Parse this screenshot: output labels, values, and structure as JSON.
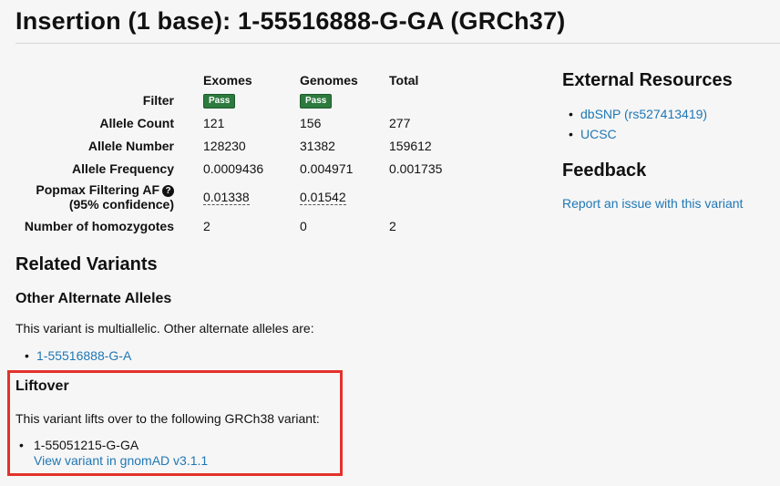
{
  "header": {
    "title": "Insertion (1 base): 1-55516888-G-GA (GRCh37)"
  },
  "frequency_table": {
    "columns": [
      "Exomes",
      "Genomes",
      "Total"
    ],
    "filter_label": "Filter",
    "filter_badges": [
      "Pass",
      "Pass"
    ],
    "rows": [
      {
        "label": "Allele Count",
        "values": [
          "121",
          "156",
          "277"
        ]
      },
      {
        "label": "Allele Number",
        "values": [
          "128230",
          "31382",
          "159612"
        ]
      },
      {
        "label": "Allele Frequency",
        "values": [
          "0.0009436",
          "0.004971",
          "0.001735"
        ]
      }
    ],
    "popmax": {
      "label_line1": "Popmax Filtering AF",
      "label_line2": "(95% confidence)",
      "values": [
        "0.01338",
        "0.01542"
      ]
    },
    "homozygotes": {
      "label": "Number of homozygotes",
      "values": [
        "2",
        "0",
        "2"
      ]
    }
  },
  "related": {
    "heading": "Related Variants",
    "other_alleles_heading": "Other Alternate Alleles",
    "other_alleles_text": "This variant is multiallelic. Other alternate alleles are:",
    "other_alleles": [
      "1-55516888-G-A"
    ]
  },
  "liftover": {
    "heading": "Liftover",
    "text": "This variant lifts over to the following GRCh38 variant:",
    "variant": "1-55051215-G-GA",
    "view_link": "View variant in gnomAD v3.1.1"
  },
  "external_resources": {
    "heading": "External Resources",
    "links": [
      "dbSNP (rs527413419)",
      "UCSC"
    ]
  },
  "feedback": {
    "heading": "Feedback",
    "link": "Report an issue with this variant"
  },
  "colors": {
    "link": "#1f77b4",
    "pass_badge": "#2d7a3e",
    "highlight_border": "#e3322b"
  }
}
